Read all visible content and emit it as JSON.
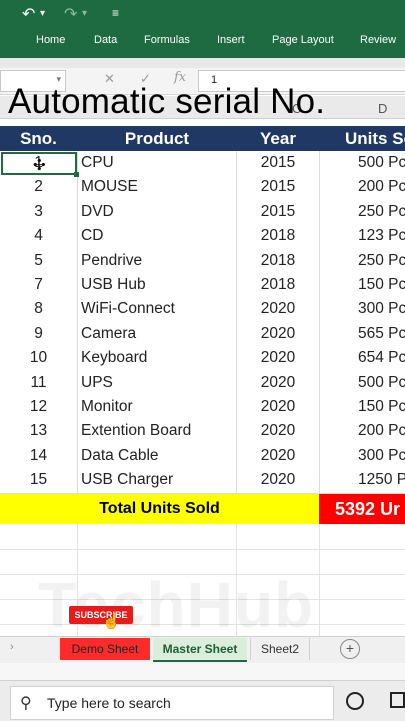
{
  "ribbon": {
    "tabs": [
      "Home",
      "Data",
      "Formulas",
      "Insert",
      "Page Layout",
      "Review"
    ]
  },
  "formula_bar": {
    "value": "1",
    "fx": "fx"
  },
  "columns": [
    "C",
    "D"
  ],
  "overlay_title": "Automatic serial No.",
  "table": {
    "headers": {
      "sno": "Sno.",
      "product": "Product",
      "year": "Year",
      "units": "Units So"
    },
    "rows": [
      {
        "sno": "1",
        "product": "CPU",
        "year": "2015",
        "units": "500 Pc"
      },
      {
        "sno": "2",
        "product": "MOUSE",
        "year": "2015",
        "units": "200 Pc"
      },
      {
        "sno": "3",
        "product": "DVD",
        "year": "2015",
        "units": "250 Pc"
      },
      {
        "sno": "4",
        "product": "CD",
        "year": "2018",
        "units": "123 Pc"
      },
      {
        "sno": "5",
        "product": "Pendrive",
        "year": "2018",
        "units": "250 Pc"
      },
      {
        "sno": "7",
        "product": "USB Hub",
        "year": "2018",
        "units": "150 Pc"
      },
      {
        "sno": "8",
        "product": "WiFi-Connect",
        "year": "2020",
        "units": "300 Pc"
      },
      {
        "sno": "9",
        "product": "Camera",
        "year": "2020",
        "units": "565 Pc"
      },
      {
        "sno": "10",
        "product": "Keyboard",
        "year": "2020",
        "units": "654 Pc"
      },
      {
        "sno": "11",
        "product": "UPS",
        "year": "2020",
        "units": "500 Pc"
      },
      {
        "sno": "12",
        "product": "Monitor",
        "year": "2020",
        "units": "150 Pc"
      },
      {
        "sno": "13",
        "product": "Extention Board",
        "year": "2020",
        "units": "200 Pc"
      },
      {
        "sno": "14",
        "product": "Data Cable",
        "year": "2020",
        "units": "300 Pc"
      },
      {
        "sno": "15",
        "product": "USB Charger",
        "year": "2020",
        "units": "1250 Pc"
      }
    ],
    "total_label": "Total Units Sold",
    "total_value": "5392 Ur"
  },
  "watermark": "TechHub",
  "subscribe_label": "SUBSCRIBE",
  "sheets": [
    "Demo Sheet",
    "Master Sheet",
    "Sheet2"
  ],
  "taskbar": {
    "search_placeholder": "Type here to search"
  },
  "colors": {
    "ribbon_green": "#1e6b42",
    "header_navy": "#1f3864",
    "total_yellow": "#ffff00",
    "total_red": "#ff0000"
  }
}
